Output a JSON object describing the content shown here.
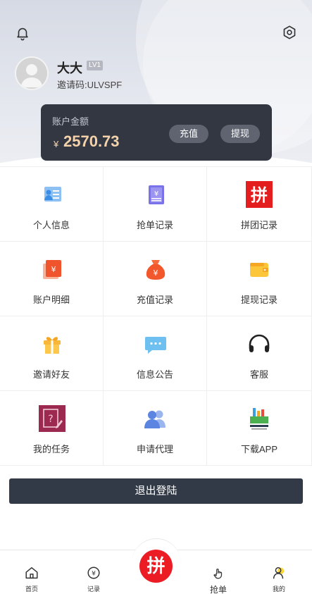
{
  "user": {
    "name": "大大",
    "level": "LV1",
    "invite_code": "邀请码:ULVSPF"
  },
  "balance": {
    "label": "账户金额",
    "currency": "¥",
    "amount": "2570.73",
    "recharge_label": "充值",
    "withdraw_label": "提现"
  },
  "grid": [
    {
      "label": "个人信息",
      "icon": "id-card-icon"
    },
    {
      "label": "抢单记录",
      "icon": "document-yen-icon"
    },
    {
      "label": "拼团记录",
      "icon": "pin-logo-icon"
    },
    {
      "label": "账户明细",
      "icon": "account-detail-icon"
    },
    {
      "label": "充值记录",
      "icon": "money-bag-icon"
    },
    {
      "label": "提现记录",
      "icon": "wallet-icon"
    },
    {
      "label": "邀请好友",
      "icon": "gift-icon"
    },
    {
      "label": "信息公告",
      "icon": "message-icon"
    },
    {
      "label": "客服",
      "icon": "headphones-icon"
    },
    {
      "label": "我的任务",
      "icon": "task-icon"
    },
    {
      "label": "申请代理",
      "icon": "users-icon"
    },
    {
      "label": "下载APP",
      "icon": "app-logo-icon"
    }
  ],
  "logout_label": "退出登陆",
  "nav": {
    "home": "首页",
    "record": "记录",
    "grab": "抢单",
    "mine": "我的"
  },
  "colors": {
    "card": "#323742",
    "amount": "#f4d2ab",
    "logout": "#323a48",
    "accent_red": "#ec1c24"
  }
}
